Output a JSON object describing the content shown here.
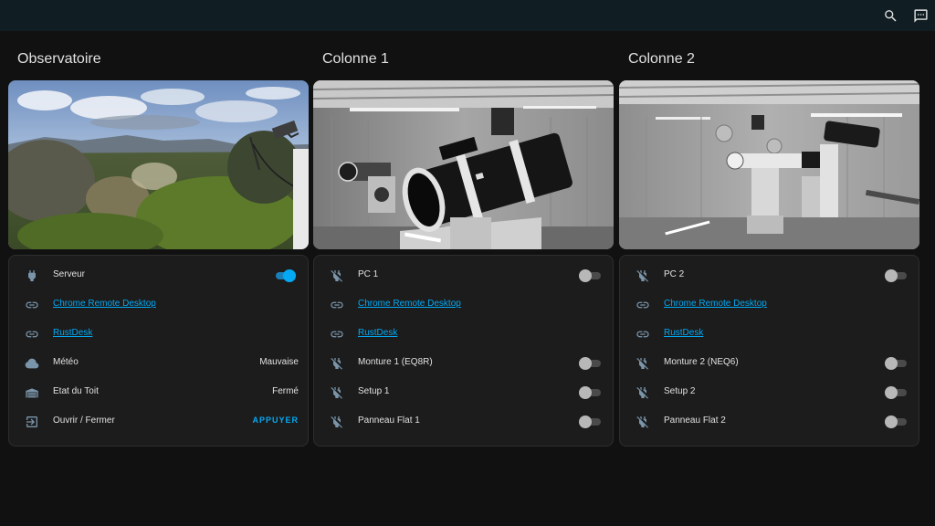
{
  "header": {
    "icons": [
      "magnify-icon",
      "chat-icon"
    ]
  },
  "columns": [
    {
      "title": "Observatoire",
      "camera": "sky-landscape-view",
      "rows": [
        {
          "icon": "power-plug-icon",
          "label": "Serveur",
          "control": "toggle",
          "state": "on"
        },
        {
          "icon": "link-icon",
          "label": "Chrome Remote Desktop",
          "control": "link"
        },
        {
          "icon": "link-icon",
          "label": "RustDesk",
          "control": "link"
        },
        {
          "icon": "cloud-icon",
          "label": "Météo",
          "control": "value",
          "value": "Mauvaise"
        },
        {
          "icon": "garage-icon",
          "label": "Etat du Toit",
          "control": "value",
          "value": "Fermé"
        },
        {
          "icon": "exit-icon",
          "label": "Ouvrir / Fermer",
          "control": "button",
          "value": "APPUYER"
        }
      ]
    },
    {
      "title": "Colonne 1",
      "camera": "telescope-camera-1",
      "rows": [
        {
          "icon": "power-plug-off-icon",
          "label": "PC 1",
          "control": "toggle",
          "state": "off"
        },
        {
          "icon": "link-icon",
          "label": "Chrome Remote Desktop",
          "control": "link"
        },
        {
          "icon": "link-icon",
          "label": "RustDesk",
          "control": "link"
        },
        {
          "icon": "power-plug-off-icon",
          "label": "Monture 1 (EQ8R)",
          "control": "toggle",
          "state": "off"
        },
        {
          "icon": "power-plug-off-icon",
          "label": "Setup 1",
          "control": "toggle",
          "state": "off"
        },
        {
          "icon": "power-plug-off-icon",
          "label": "Panneau Flat 1",
          "control": "toggle",
          "state": "off"
        }
      ]
    },
    {
      "title": "Colonne 2",
      "camera": "telescope-camera-2",
      "rows": [
        {
          "icon": "power-plug-off-icon",
          "label": "PC 2",
          "control": "toggle",
          "state": "off"
        },
        {
          "icon": "link-icon",
          "label": "Chrome Remote Desktop",
          "control": "link"
        },
        {
          "icon": "link-icon",
          "label": "RustDesk",
          "control": "link"
        },
        {
          "icon": "power-plug-off-icon",
          "label": "Monture 2 (NEQ6)",
          "control": "toggle",
          "state": "off"
        },
        {
          "icon": "power-plug-off-icon",
          "label": "Setup 2",
          "control": "toggle",
          "state": "off"
        },
        {
          "icon": "power-plug-off-icon",
          "label": "Panneau Flat 2",
          "control": "toggle",
          "state": "off"
        }
      ]
    }
  ],
  "colors": {
    "accent": "#03a9f4",
    "background": "#111111",
    "card": "#1c1c1c",
    "header": "#101e24",
    "icon": "#7a95aa"
  }
}
